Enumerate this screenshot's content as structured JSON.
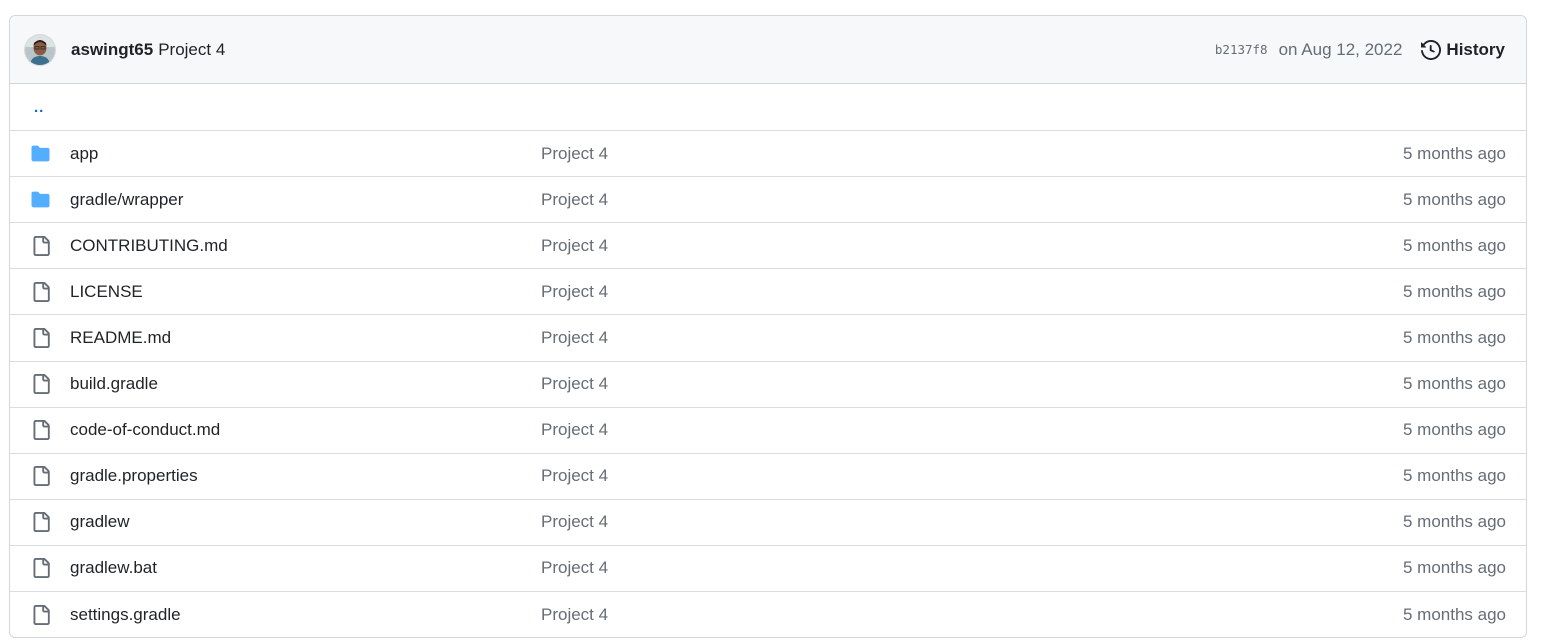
{
  "header": {
    "author": "aswingt65",
    "commit_message": "Project 4",
    "sha": "b2137f8",
    "date": "on Aug 12, 2022",
    "history_label": "History"
  },
  "parent_link": "..",
  "files": [
    {
      "name": "app",
      "type": "folder",
      "message": "Project 4",
      "age": "5 months ago"
    },
    {
      "name": "gradle/wrapper",
      "type": "folder",
      "message": "Project 4",
      "age": "5 months ago"
    },
    {
      "name": "CONTRIBUTING.md",
      "type": "file",
      "message": "Project 4",
      "age": "5 months ago"
    },
    {
      "name": "LICENSE",
      "type": "file",
      "message": "Project 4",
      "age": "5 months ago"
    },
    {
      "name": "README.md",
      "type": "file",
      "message": "Project 4",
      "age": "5 months ago"
    },
    {
      "name": "build.gradle",
      "type": "file",
      "message": "Project 4",
      "age": "5 months ago"
    },
    {
      "name": "code-of-conduct.md",
      "type": "file",
      "message": "Project 4",
      "age": "5 months ago"
    },
    {
      "name": "gradle.properties",
      "type": "file",
      "message": "Project 4",
      "age": "5 months ago"
    },
    {
      "name": "gradlew",
      "type": "file",
      "message": "Project 4",
      "age": "5 months ago"
    },
    {
      "name": "gradlew.bat",
      "type": "file",
      "message": "Project 4",
      "age": "5 months ago"
    },
    {
      "name": "settings.gradle",
      "type": "file",
      "message": "Project 4",
      "age": "5 months ago"
    }
  ],
  "colors": {
    "folder_icon": "#54aeff",
    "file_icon": "#656d76",
    "link": "#0969da",
    "header_bg": "#f6f8fa",
    "border": "#d0d7de"
  },
  "icons": {
    "folder": "folder-icon",
    "file": "file-icon",
    "history": "history-icon",
    "avatar": "avatar"
  }
}
